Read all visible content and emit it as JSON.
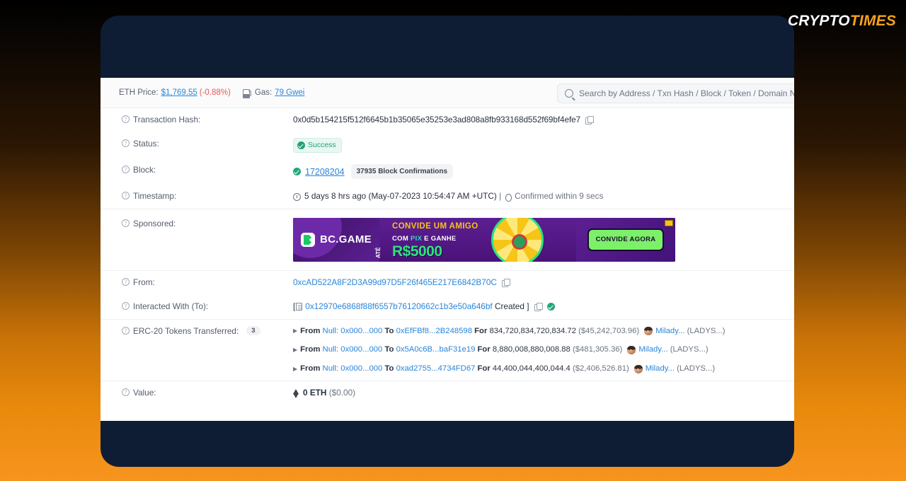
{
  "brand": {
    "part1": "CRYPTO",
    "part2": "TIMES",
    "color1": "#ffffff",
    "color2": "#f5a21c"
  },
  "topbar": {
    "eth_price_label": "ETH Price:",
    "eth_price_value": "$1,769.55",
    "eth_price_change": "(-0.88%)",
    "gas_label": "Gas:",
    "gas_value": "79 Gwei",
    "gas_icon": "gas-pump-icon",
    "search_placeholder": "Search by Address / Txn Hash / Block / Token / Domain Name",
    "search_value": "",
    "search_icon": "search-icon",
    "theme_icon": "sun-icon",
    "network_icon": "ethereum-diamond-icon"
  },
  "rows": {
    "txhash": {
      "label": "Transaction Hash:",
      "value": "0x0d5b154215f512f6645b1b35065e35253e3ad808a8fb933168d552f69bf4efe7",
      "copy_icon": "copy-icon"
    },
    "status": {
      "label": "Status:",
      "badge": "Success",
      "badge_icon": "check-circle-icon"
    },
    "block": {
      "label": "Block:",
      "number": "17208204",
      "confirmations": "37935 Block Confirmations",
      "icon": "check-circle-icon"
    },
    "timestamp": {
      "label": "Timestamp:",
      "ago": "5 days 8 hrs ago",
      "absolute": "(May-07-2023 10:54:47 AM +UTC)",
      "separator": "|",
      "confirmed": "Confirmed within 9 secs",
      "clock_icon": "clock-icon",
      "hourglass_icon": "hourglass-icon"
    },
    "sponsored": {
      "label": "Sponsored:",
      "ad": {
        "brand": "BC.GAME",
        "line1": "CONVIDE UM AMIGO",
        "line2_pre": "COM ",
        "line2_pix": "PIX",
        "line2_post": " E GANHE",
        "ate": "ATÉ",
        "amount": "R$5000",
        "cta": "CONVIDE AGORA",
        "close_icon": "ad-close-icon"
      }
    },
    "from": {
      "label": "From:",
      "address": "0xcAD522A8F2D3A99d97D5F26f465E217E6842B70C",
      "copy_icon": "copy-icon"
    },
    "to": {
      "label": "Interacted With (To):",
      "open_bracket": "[",
      "address": "0x12970e6868f88f6557b76120662c1b3e50a646bf",
      "created": "Created",
      "close_bracket": "]",
      "contract_icon": "contract-document-icon",
      "copy_icon": "copy-icon",
      "verified_icon": "verified-check-icon"
    },
    "erc20": {
      "label": "ERC-20 Tokens Transferred:",
      "count": "3",
      "transfers": [
        {
          "from_label": "From",
          "from": "Null: 0x000...000",
          "to_label": "To",
          "to": "0xEfFBf8...2B248598",
          "for_label": "For",
          "amount": "834,720,834,720,834.72",
          "usd": "($45,242,703.96)",
          "token": "Milady...",
          "symbol": "(LADYS...)",
          "token_icon": "milady-token-icon"
        },
        {
          "from_label": "From",
          "from": "Null: 0x000...000",
          "to_label": "To",
          "to": "0x5A0c6B...baF31e19",
          "for_label": "For",
          "amount": "8,880,008,880,008.88",
          "usd": "($481,305.36)",
          "token": "Milady...",
          "symbol": "(LADYS...)",
          "token_icon": "milady-token-icon"
        },
        {
          "from_label": "From",
          "from": "Null: 0x000...000",
          "to_label": "To",
          "to": "0xad2755...4734FD67",
          "for_label": "For",
          "amount": "44,400,044,400,044.4",
          "usd": "($2,406,526.81)",
          "token": "Milady...",
          "symbol": "(LADYS...)",
          "token_icon": "milady-token-icon"
        }
      ]
    },
    "value": {
      "label": "Value:",
      "amount": "0 ETH",
      "usd": "($0.00)",
      "icon": "ethereum-diamond-icon"
    }
  }
}
